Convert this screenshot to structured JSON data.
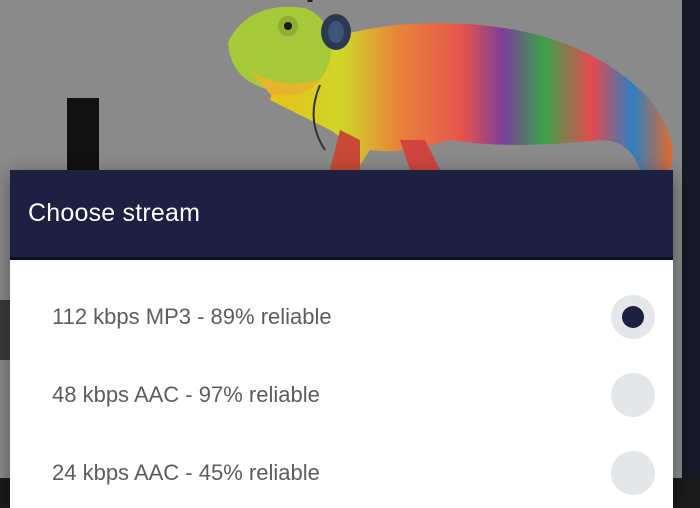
{
  "dialog": {
    "title": "Choose stream",
    "options": [
      {
        "label": "112 kbps MP3 - 89% reliable",
        "selected": true
      },
      {
        "label": "48 kbps AAC - 97% reliable",
        "selected": false
      },
      {
        "label": "24 kbps AAC - 45% reliable",
        "selected": false
      }
    ]
  },
  "colors": {
    "header_bg": "#1d2040",
    "radio_selected": "#1d2040",
    "radio_unselected": "#e5e6ea",
    "option_text": "#5d5d5d"
  },
  "icons": {
    "mascot": "rainbow-chameleon-with-headphones"
  }
}
